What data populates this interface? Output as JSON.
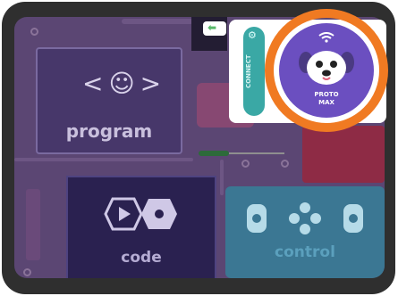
{
  "tiles": {
    "program_label": "program",
    "code_label": "code",
    "control_label": "control"
  },
  "popup": {
    "connect_label": "CONNECT"
  },
  "robot": {
    "name_line1": "PROTO",
    "name_line2": "MAX",
    "highlighted": true
  },
  "icons": {
    "program": "smiley-brackets-icon",
    "code": "play-blocks-icon",
    "control": "gamepad-icon",
    "wifi": "wifi-icon",
    "connect": "gear-icon",
    "back": "arrow-left-icon"
  },
  "colors": {
    "highlight_ring": "#f07a22",
    "robot_badge": "#6b4fc0",
    "connect_strip": "#3aa8a5",
    "control_tile": "#3b7793",
    "screen_background": "#5b4673"
  }
}
